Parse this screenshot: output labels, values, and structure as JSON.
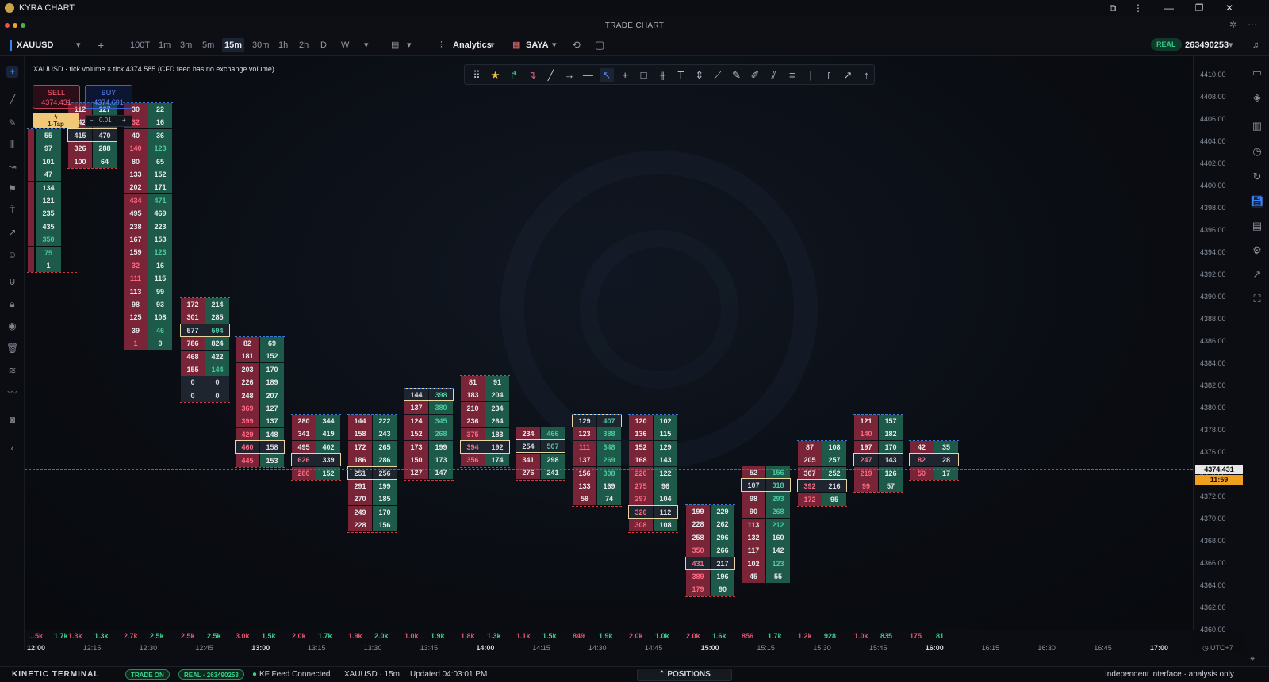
{
  "app": {
    "title": "KYRA CHART",
    "window_title": "TRADE CHART"
  },
  "toolbar": {
    "symbol": "XAUUSD",
    "timeframes": [
      "100T",
      "1m",
      "3m",
      "5m",
      "15m",
      "30m",
      "1h",
      "2h",
      "D",
      "W"
    ],
    "active_timeframe": "15m",
    "analytics_label": "Analytics",
    "template_label": "SAYA",
    "account_mode": "REAL",
    "account_id": "263490253"
  },
  "trade_panel": {
    "notice": "XAUUSD · tick volume × tick 4374.585 (CFD feed has no exchange volume)",
    "sell_label": "SELL",
    "sell_price": "4374.431",
    "buy_label": "BUY",
    "buy_price": "4374.691",
    "one_tap_label": "1-Tap",
    "qty_minus": "−",
    "qty_value": "0.01",
    "qty_plus": "+"
  },
  "price_axis": {
    "labels": [
      "4410.00",
      "4408.00",
      "4406.00",
      "4404.00",
      "4402.00",
      "4400.00",
      "4398.00",
      "4396.00",
      "4394.00",
      "4392.00",
      "4390.00",
      "4388.00",
      "4386.00",
      "4384.00",
      "4382.00",
      "4380.00",
      "4378.00",
      "4376.00",
      "4374.00",
      "4372.00",
      "4370.00",
      "4368.00",
      "4366.00",
      "4364.00",
      "4362.00",
      "4360.00"
    ],
    "current_price": "4374.431",
    "countdown": "11:59"
  },
  "volume_row": [
    "…5k",
    "1.7k",
    "1.3k",
    "1.3k",
    "2.7k",
    "2.5k",
    "2.5k",
    "2.5k",
    "3.0k",
    "1.5k",
    "2.0k",
    "1.7k",
    "1.9k",
    "2.0k",
    "1.0k",
    "1.9k",
    "1.8k",
    "1.3k",
    "1.1k",
    "1.5k",
    "849",
    "1.9k",
    "2.0k",
    "1.0k",
    "2.0k",
    "1.6k",
    "856",
    "1.7k",
    "1.2k",
    "928",
    "1.0k",
    "835",
    "175",
    "81"
  ],
  "time_axis": [
    "12:00",
    "12:15",
    "12:30",
    "12:45",
    "13:00",
    "13:15",
    "13:30",
    "13:45",
    "14:00",
    "14:15",
    "14:30",
    "14:45",
    "15:00",
    "15:15",
    "15:30",
    "15:45",
    "16:00",
    "16:15",
    "16:30",
    "16:45",
    "17:00"
  ],
  "timezone": "UTC+7",
  "status": {
    "brand": "KINETIC TERMINAL",
    "trade_on": "TRADE ON",
    "real_pill": "REAL · 263490253",
    "feed": "KF Feed Connected",
    "instrument": "XAUUSD · 15m",
    "updated": "Updated 04:03:01 PM",
    "positions": "⌃ POSITIONS",
    "disclaimer": "Independent interface · analysis only"
  },
  "colors": {
    "sell": "#7a2437",
    "buy": "#1e5a49",
    "current_line": "#d0393f",
    "accent": "#3b82f6",
    "countdown_bg": "#f0a020"
  },
  "icons": {
    "left": [
      "crosshair-icon",
      "trendline-icon",
      "brush-icon",
      "fib-icon",
      "path-icon",
      "flag-icon",
      "pin-icon",
      "ray-icon",
      "emoji-icon",
      "magnet-icon",
      "lock-icon",
      "eye-icon",
      "trash-icon",
      "layers-icon",
      "wave-icon",
      "camera-icon",
      "collapse-icon"
    ],
    "right": [
      "watchlist-icon",
      "layers-icon",
      "chart-icon",
      "history-icon",
      "refresh-icon",
      "save-icon",
      "layout-icon",
      "settings-icon",
      "trend-icon",
      "fullscreen-icon"
    ]
  },
  "footprint": [
    {
      "time": "12:00",
      "rows": [
        [
          "55",
          "55"
        ],
        [
          "97",
          "97"
        ],
        [
          "101",
          "101"
        ],
        [
          "47",
          "47"
        ],
        [
          "134",
          "134"
        ],
        [
          "121",
          "121"
        ],
        [
          "235",
          "235"
        ],
        [
          "435",
          "435"
        ],
        [
          "350",
          "350"
        ],
        [
          "75",
          "75"
        ],
        [
          "1",
          "1"
        ]
      ]
    },
    {
      "time": "12:15",
      "rows": [
        [
          "112",
          "127"
        ],
        [
          "142",
          "142"
        ],
        [
          "415",
          "470"
        ],
        [
          "326",
          "288"
        ],
        [
          "100",
          "64"
        ]
      ]
    },
    {
      "time": "12:30",
      "rows": [
        [
          "30",
          "22"
        ],
        [
          "32",
          "16"
        ],
        [
          "40",
          "36"
        ],
        [
          "140",
          "123"
        ],
        [
          "80",
          "65"
        ],
        [
          "133",
          "152"
        ],
        [
          "202",
          "171"
        ],
        [
          "434",
          "471"
        ],
        [
          "495",
          "469"
        ],
        [
          "238",
          "223"
        ],
        [
          "167",
          "153"
        ],
        [
          "159",
          "123"
        ],
        [
          "32",
          "16"
        ],
        [
          "111",
          "115"
        ],
        [
          "113",
          "99"
        ],
        [
          "98",
          "93"
        ],
        [
          "125",
          "108"
        ],
        [
          "39",
          "46"
        ],
        [
          "1",
          "0"
        ]
      ]
    },
    {
      "time": "12:45",
      "rows": [
        [
          "172",
          "214"
        ],
        [
          "301",
          "285"
        ],
        [
          "577",
          "594"
        ],
        [
          "786",
          "824"
        ],
        [
          "468",
          "422"
        ],
        [
          "155",
          "144"
        ],
        [
          "0",
          "0"
        ],
        [
          "0",
          "0"
        ]
      ]
    },
    {
      "time": "13:00",
      "rows": [
        [
          "82",
          "69"
        ],
        [
          "181",
          "152"
        ],
        [
          "203",
          "170"
        ],
        [
          "226",
          "189"
        ],
        [
          "248",
          "207"
        ],
        [
          "369",
          "127"
        ],
        [
          "399",
          "137"
        ],
        [
          "429",
          "148"
        ],
        [
          "460",
          "158"
        ],
        [
          "445",
          "153"
        ]
      ]
    },
    {
      "time": "13:15",
      "rows": [
        [
          "280",
          "344"
        ],
        [
          "341",
          "419"
        ],
        [
          "495",
          "402"
        ],
        [
          "626",
          "339"
        ],
        [
          "280",
          "152"
        ]
      ]
    },
    {
      "time": "13:30",
      "rows": [
        [
          "144",
          "222"
        ],
        [
          "158",
          "243"
        ],
        [
          "172",
          "265"
        ],
        [
          "186",
          "286"
        ],
        [
          "251",
          "256"
        ],
        [
          "291",
          "199"
        ],
        [
          "270",
          "185"
        ],
        [
          "249",
          "170"
        ],
        [
          "228",
          "156"
        ]
      ]
    },
    {
      "time": "13:45",
      "rows": [
        [
          "144",
          "398"
        ],
        [
          "137",
          "380"
        ],
        [
          "124",
          "345"
        ],
        [
          "152",
          "268"
        ],
        [
          "173",
          "199"
        ],
        [
          "150",
          "173"
        ],
        [
          "127",
          "147"
        ]
      ]
    },
    {
      "time": "14:00",
      "rows": [
        [
          "81",
          "91"
        ],
        [
          "183",
          "204"
        ],
        [
          "210",
          "234"
        ],
        [
          "236",
          "264"
        ],
        [
          "375",
          "183"
        ],
        [
          "394",
          "192"
        ],
        [
          "356",
          "174"
        ]
      ]
    },
    {
      "time": "14:15",
      "rows": [
        [
          "234",
          "466"
        ],
        [
          "254",
          "507"
        ],
        [
          "341",
          "298"
        ],
        [
          "276",
          "241"
        ]
      ]
    },
    {
      "time": "14:30",
      "rows": [
        [
          "129",
          "407"
        ],
        [
          "123",
          "388"
        ],
        [
          "111",
          "348"
        ],
        [
          "137",
          "269"
        ],
        [
          "156",
          "308"
        ],
        [
          "133",
          "169"
        ],
        [
          "58",
          "74"
        ]
      ]
    },
    {
      "time": "14:45",
      "rows": [
        [
          "120",
          "102"
        ],
        [
          "136",
          "115"
        ],
        [
          "152",
          "129"
        ],
        [
          "168",
          "143"
        ],
        [
          "220",
          "122"
        ],
        [
          "275",
          "96"
        ],
        [
          "297",
          "104"
        ],
        [
          "320",
          "112"
        ],
        [
          "308",
          "108"
        ]
      ]
    },
    {
      "time": "15:00",
      "rows": [
        [
          "199",
          "229"
        ],
        [
          "228",
          "262"
        ],
        [
          "258",
          "296"
        ],
        [
          "350",
          "266"
        ],
        [
          "431",
          "217"
        ],
        [
          "389",
          "196"
        ],
        [
          "179",
          "90"
        ]
      ]
    },
    {
      "time": "15:15",
      "rows": [
        [
          "52",
          "156"
        ],
        [
          "107",
          "318"
        ],
        [
          "98",
          "293"
        ],
        [
          "90",
          "268"
        ],
        [
          "113",
          "212"
        ],
        [
          "132",
          "160"
        ],
        [
          "117",
          "142"
        ],
        [
          "102",
          "123"
        ],
        [
          "45",
          "55"
        ]
      ]
    },
    {
      "time": "15:30",
      "rows": [
        [
          "87",
          "108"
        ],
        [
          "205",
          "257"
        ],
        [
          "307",
          "252"
        ],
        [
          "392",
          "216"
        ],
        [
          "172",
          "95"
        ]
      ]
    },
    {
      "time": "15:45",
      "rows": [
        [
          "121",
          "157"
        ],
        [
          "140",
          "182"
        ],
        [
          "197",
          "170"
        ],
        [
          "247",
          "143"
        ],
        [
          "219",
          "126"
        ],
        [
          "99",
          "57"
        ]
      ]
    },
    {
      "time": "16:00",
      "rows": [
        [
          "42",
          "35"
        ],
        [
          "82",
          "28"
        ],
        [
          "50",
          "17"
        ]
      ]
    }
  ]
}
